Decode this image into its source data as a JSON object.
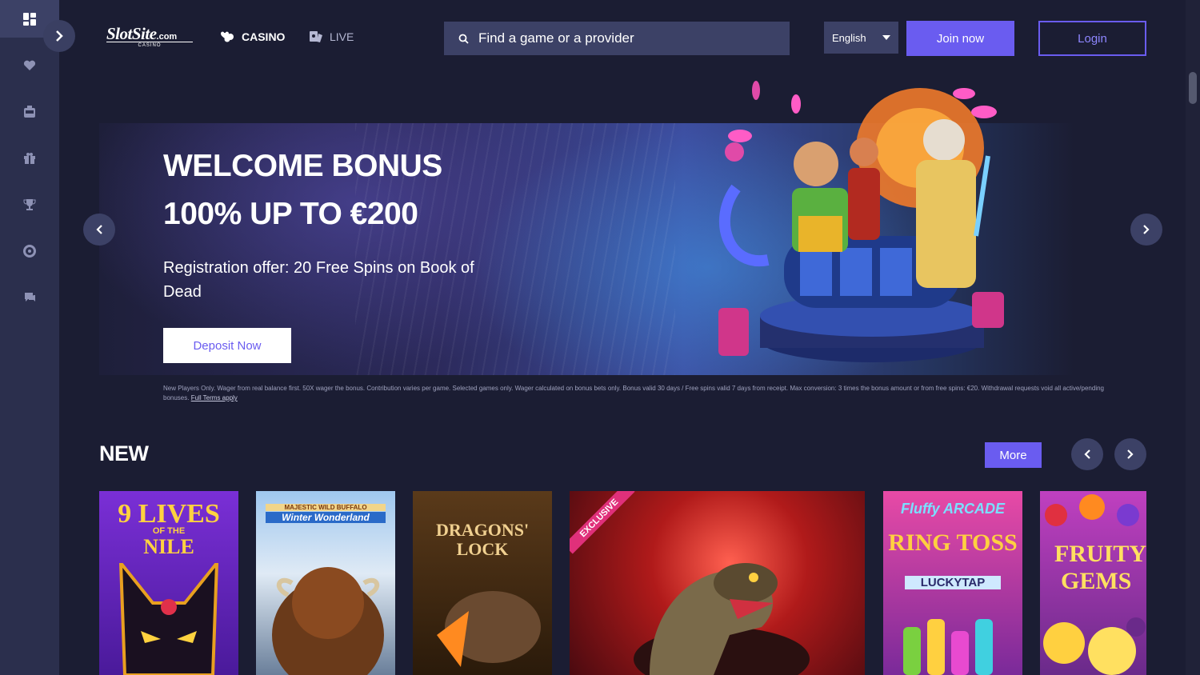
{
  "colors": {
    "accent": "#6a5cf0",
    "panel": "#3c4166",
    "rail": "#2b2f4d",
    "bg": "#1b1d33"
  },
  "header": {
    "logo_text": "SlotSite",
    "logo_suffix": ".com",
    "logo_sub": "CASINO",
    "nav": [
      {
        "label": "CASINO",
        "icon": "cards-icon"
      },
      {
        "label": "LIVE",
        "icon": "live-dealer-icon"
      }
    ],
    "search_placeholder": "Find a game or a provider",
    "language": "English",
    "join_label": "Join now",
    "login_label": "Login"
  },
  "sidebar": {
    "items": [
      {
        "icon": "dashboard-icon"
      },
      {
        "icon": "heart-icon"
      },
      {
        "icon": "slot-machine-icon"
      },
      {
        "icon": "gift-icon"
      },
      {
        "icon": "trophy-icon"
      },
      {
        "icon": "support-lifebuoy-icon"
      },
      {
        "icon": "chat-help-icon"
      }
    ]
  },
  "hero": {
    "title_line1": "WELCOME BONUS",
    "title_line2": "100% UP TO €200",
    "subtitle": "Registration offer: 20 Free Spins on Book of Dead",
    "cta_label": "Deposit Now",
    "terms": "New Players Only. Wager from real balance first. 50X wager the bonus. Contribution varies per game. Selected games only. Wager calculated on bonus bets only. Bonus valid 30 days / Free spins valid 7 days from receipt. Max conversion: 3 times the bonus amount or from free spins: €20. Withdrawal requests void all active/pending bonuses.",
    "terms_link": "Full Terms apply"
  },
  "new_section": {
    "title": "NEW",
    "more_label": "More",
    "games": [
      {
        "name": "9 LIVES OF THE NILE",
        "line1": "9 LIVES",
        "line2": "OF THE",
        "line3": "NILE"
      },
      {
        "name": "MAJESTIC WILD BUFFALO Winter Wonderland",
        "line1": "MAJESTIC WILD BUFFALO",
        "line2": "Winter Wonderland"
      },
      {
        "name": "DRAGONS' LOCK",
        "line1": "DRAGONS'",
        "line2": "LOCK"
      },
      {
        "name": "EXCLUSIVE cobra",
        "badge": "EXCLUSIVE"
      },
      {
        "name": "Fluffy Arcade Ring Toss Lucky Tap",
        "line1": "Fluffy ARCADE",
        "line2": "RING TOSS",
        "line3": "LUCKYTAP"
      },
      {
        "name": "FRUITY GEMS",
        "line1": "FRUITY",
        "line2": "GEMS"
      }
    ]
  }
}
